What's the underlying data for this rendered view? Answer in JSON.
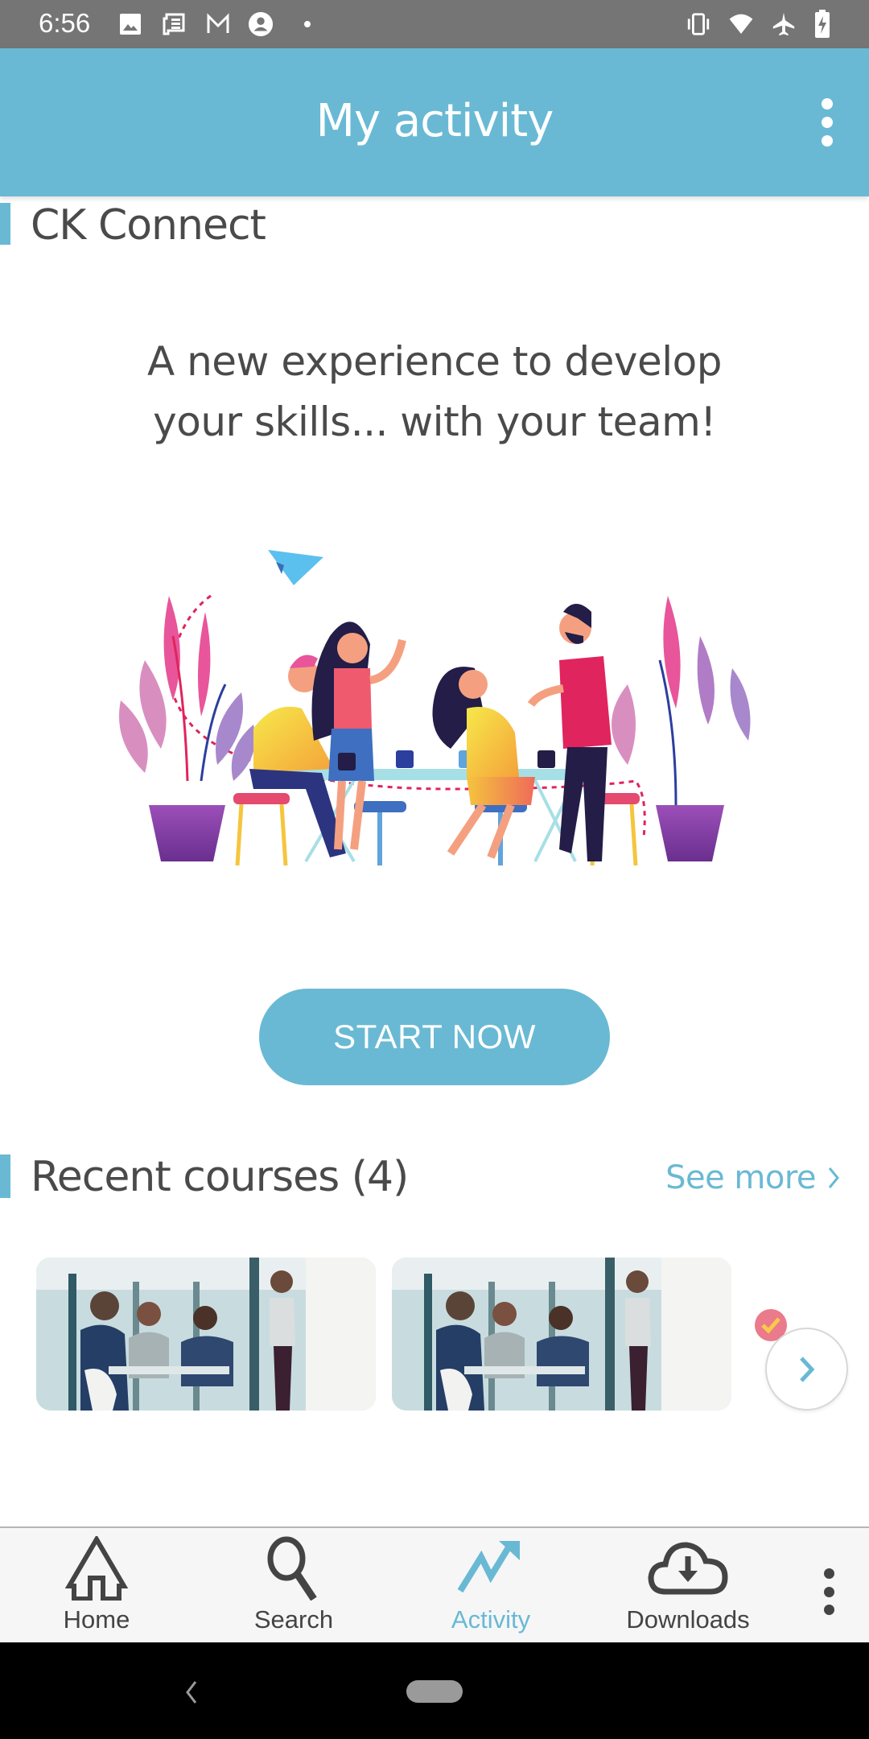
{
  "status_bar": {
    "time": "6:56",
    "left_icons": [
      "image-icon",
      "news-icon",
      "gmail-icon",
      "account-icon",
      "dot-icon"
    ],
    "right_icons": [
      "vibrate-icon",
      "wifi-icon",
      "airplane-icon",
      "battery-charging-icon"
    ]
  },
  "app_bar": {
    "title": "My activity",
    "menu_icon": "more-vert-icon"
  },
  "ck_connect": {
    "section_title": "CK Connect",
    "headline": "A new experience to develop your skills... with your team!",
    "illustration": "team-meeting-illustration",
    "start_button": "START NOW"
  },
  "recent_courses": {
    "section_title": "Recent courses (4)",
    "see_more": "See more",
    "courses": [
      {
        "image": "office-meeting-photo"
      },
      {
        "image": "office-meeting-photo"
      },
      {
        "image": "completed-badge"
      }
    ],
    "next_icon": "chevron-right-icon"
  },
  "bottom_nav": {
    "items": [
      {
        "label": "Home",
        "icon": "home-icon",
        "active": false
      },
      {
        "label": "Search",
        "icon": "search-icon",
        "active": false
      },
      {
        "label": "Activity",
        "icon": "trending-up-icon",
        "active": true
      },
      {
        "label": "Downloads",
        "icon": "cloud-download-icon",
        "active": false
      }
    ],
    "more_icon": "more-vert-icon"
  },
  "colors": {
    "accent": "#69b9d4",
    "text": "#4a4a4a",
    "status_bar": "#757575",
    "nav_bg": "#f6f6f6"
  }
}
